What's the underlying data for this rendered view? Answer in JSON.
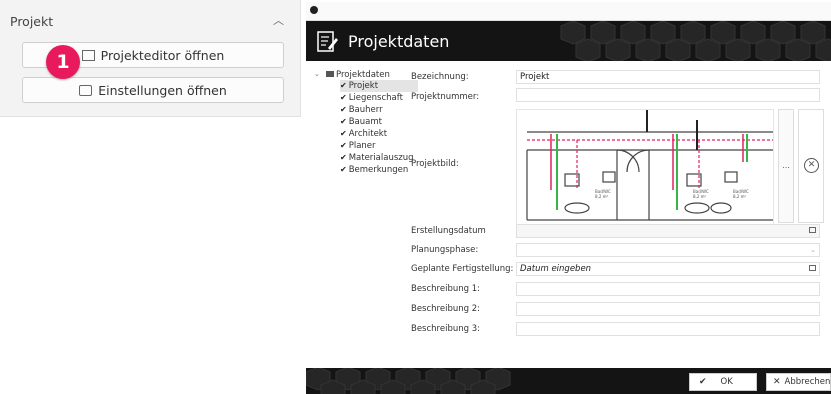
{
  "left_panel": {
    "title": "Projekt",
    "collapse_icon": "chevron-up-icon",
    "buttons": [
      {
        "label": "Projekteditor öffnen",
        "icon": "edit-icon"
      },
      {
        "label": "Einstellungen öffnen",
        "icon": "settings-icon"
      }
    ],
    "step_badge": "1",
    "badge_color": "#e81a5c"
  },
  "dialog": {
    "title": "Projektdaten",
    "header_icon": "edit-document-icon",
    "tree": {
      "root": "Projektdaten",
      "items": [
        "Projekt",
        "Liegenschaft",
        "Bauherr",
        "Bauamt",
        "Architekt",
        "Planer",
        "Materialauszug",
        "Bemerkungen"
      ],
      "selected": "Projekt"
    },
    "fields": {
      "bezeichnung": {
        "label": "Bezeichnung:",
        "value": "Projekt"
      },
      "projektnummer": {
        "label": "Projektnummer:",
        "value": ""
      },
      "projektbild": {
        "label": "Projektbild:",
        "browse": "..."
      },
      "erstellungsdatum": {
        "label": "Erstellungsdatum",
        "value": ""
      },
      "planungsphase": {
        "label": "Planungsphase:",
        "value": ""
      },
      "fertigstellung": {
        "label": "Geplante Fertigstellung:",
        "placeholder": "Datum eingeben"
      },
      "beschreibung1": {
        "label": "Beschreibung 1:",
        "value": ""
      },
      "beschreibung2": {
        "label": "Beschreibung 2:",
        "value": ""
      },
      "beschreibung3": {
        "label": "Beschreibung 3:",
        "value": ""
      }
    },
    "image_labels": [
      "Bad/WC\n8,2 m²",
      "Bad/WC\n8,2 m²",
      "Bad/WC\n8,2 m²",
      "Bad/WC\n8,2 m²"
    ],
    "footer": {
      "ok": "OK",
      "cancel": "Abbrechen"
    }
  }
}
